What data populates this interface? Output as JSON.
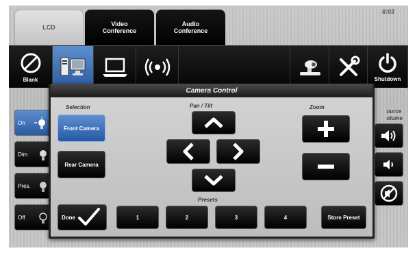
{
  "clock": "8:03",
  "tabs": {
    "lcd": "LCD",
    "video": "Video\nConference",
    "audio": "Audio\nConference"
  },
  "sources": {
    "blank": "Blank",
    "shutdown": "Shutdown"
  },
  "lighting": {
    "on": "On",
    "dim": "Dim",
    "pres": "Pres.",
    "off": "Off"
  },
  "right_panel": {
    "label": "ource\nolume"
  },
  "camera": {
    "title": "Camera Control",
    "selection_label": "Selection",
    "pan_tilt_label": "Pan / Tilt",
    "zoom_label": "Zoom",
    "presets_label": "Presets",
    "front_camera": "Front Camera",
    "rear_camera": "Rear Camera",
    "done": "Done",
    "presets": [
      "1",
      "2",
      "3",
      "4"
    ],
    "store_preset": "Store Preset"
  },
  "colors": {
    "selected_blue": "#3b6fb8",
    "button_black": "#000000"
  }
}
